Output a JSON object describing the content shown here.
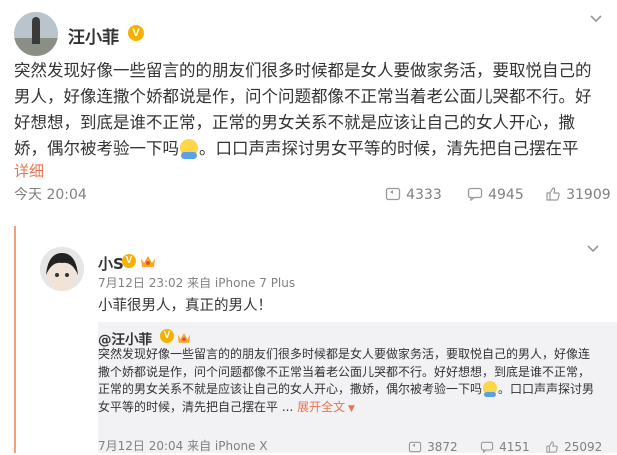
{
  "post": {
    "author": "汪小菲",
    "text_lines": [
      "突然发现好像一些留言的的朋友们很多时候都是女人要做家务活，要取悦自己的",
      "男人，好像连撒个娇都说是作，问个问题都像不正常当着老公面儿哭都不行。好",
      "好想想，到底是谁不正常，正常的男女关系不就是应该让自己的女人开心，撒",
      "娇，偶尔被考验一下吗",
      "。口口声声探讨男女平等的时候，清先把自己摆在平"
    ],
    "detail_link": "详细",
    "time": "今天 20:04",
    "reposts": "4333",
    "comments": "4945",
    "likes": "31909"
  },
  "repost": {
    "author": "小S",
    "meta": "7月12日 23:02 来自 iPhone 7 Plus",
    "text": "小菲很男人，真正的男人！",
    "quoted": {
      "author": "@汪小菲",
      "lines": [
        "突然发现好像一些留言的的朋友们很多时候都是女人要做家务活，要取悦自己的男人，好像连",
        "撒个娇都说是作，问个问题都像不正常当着老公面儿哭都不行。好好想想，到底是谁不正常，",
        "正常的男女关系不就是应该让自己的女人开心，撒娇，偶尔被考验一下吗",
        "。口口声声探讨男",
        "女平等的时候，清先把自己摆在平 ...",
        "展开全文"
      ],
      "meta": "7月12日 20:04 来自 iPhone X",
      "reposts": "3872",
      "comments": "4151",
      "likes": "25092"
    }
  }
}
